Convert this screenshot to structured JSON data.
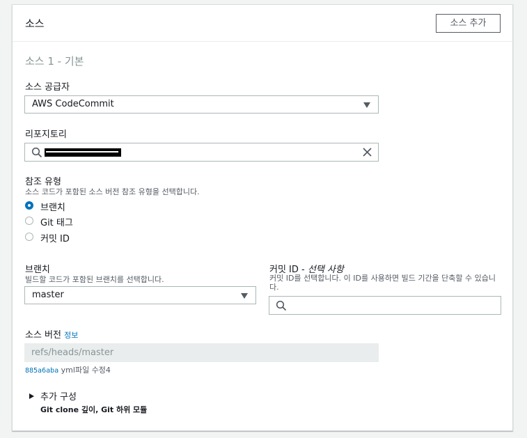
{
  "header": {
    "title": "소스",
    "add_source_label": "소스 추가"
  },
  "section": {
    "title": "소스 1 - 기본"
  },
  "provider": {
    "label": "소스 공급자",
    "value": "AWS CodeCommit"
  },
  "repository": {
    "label": "리포지토리"
  },
  "reference_type": {
    "label": "참조 유형",
    "description": "소스 코드가 포함된 소스 버전 참조 유형을 선택합니다.",
    "options": [
      {
        "label": "브랜치",
        "selected": true
      },
      {
        "label": "Git 태그",
        "selected": false
      },
      {
        "label": "커밋 ID",
        "selected": false
      }
    ]
  },
  "branch": {
    "label": "브랜치",
    "description": "빌드할 코드가 포함된 브랜치를 선택합니다.",
    "value": "master"
  },
  "commit_id": {
    "label": "커밋 ID - ",
    "label_optional": "선택 사항",
    "description": "커밋 ID를 선택합니다. 이 ID를 사용하면 빌드 기간을 단축할 수 있습니다."
  },
  "source_version": {
    "label": "소스 버전",
    "info_link": "정보",
    "value": "refs/heads/master",
    "commit_hash": "885a6aba",
    "commit_message": "yml파일 수정4"
  },
  "additional_config": {
    "title": "추가 구성",
    "subtitle": "Git clone 깊이, Git 하위 모듈"
  },
  "colors": {
    "accent": "#0073bb",
    "border": "#aab7b8"
  }
}
